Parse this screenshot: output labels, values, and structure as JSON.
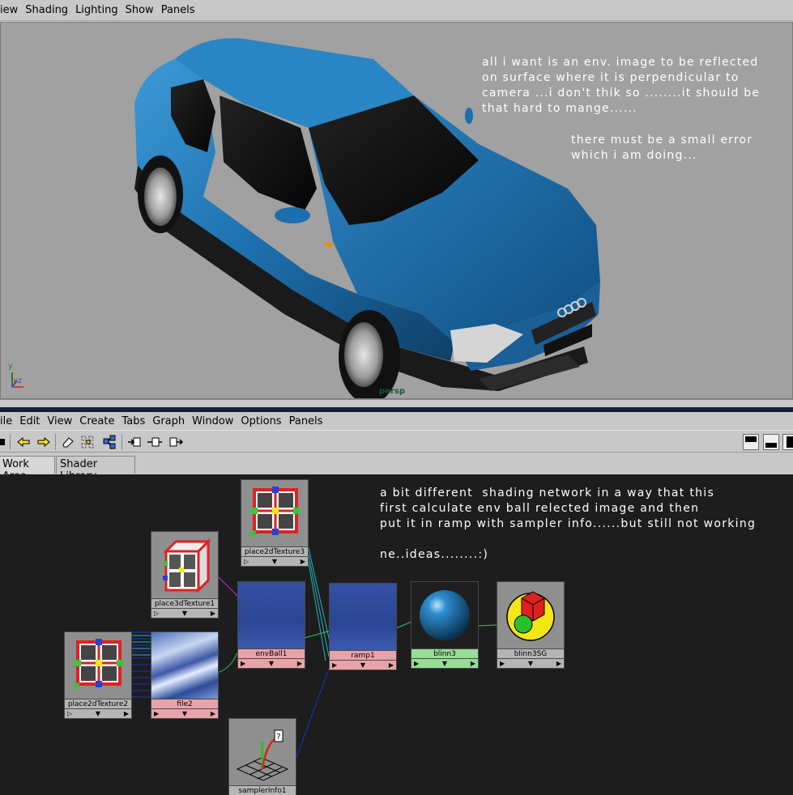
{
  "viewport": {
    "menu": [
      "iew",
      "Shading",
      "Lighting",
      "Show",
      "Panels"
    ],
    "camera_label": "persp",
    "note_1": "all i want is an env. image to be reflected\non surface where it is perpendicular to\ncamera ...i don't thik so ........it should be\nthat hard to mange......",
    "note_2": "there must be a small error\nwhich i am doing...",
    "axis_labels": [
      "y",
      "x",
      "z"
    ]
  },
  "hypershade": {
    "menu": [
      "ile",
      "Edit",
      "View",
      "Create",
      "Tabs",
      "Graph",
      "Window",
      "Options",
      "Panels"
    ],
    "tabs": [
      "Work Area",
      "Shader Library"
    ],
    "note": "a bit different  shading network in a way that this\nfirst calculate env ball relected image and then\nput it in ramp with sampler info......but still not working\n\nne..ideas........:)",
    "nodes": {
      "place2dTexture3": "place2dTexture3",
      "place3dTexture1": "place3dTexture1",
      "place2dTexture2": "place2dTexture2",
      "file2": "file2",
      "envBall1": "envBall1",
      "ramp1": "ramp1",
      "blinn3": "blinn3",
      "blinn3SG": "blinn3SG",
      "samplerInfo1": "samplerInfo1"
    }
  },
  "colors": {
    "viewport_bg": "#a1a1a1",
    "work_bg": "#1d1d1d",
    "car_body": "#1f74b3"
  }
}
